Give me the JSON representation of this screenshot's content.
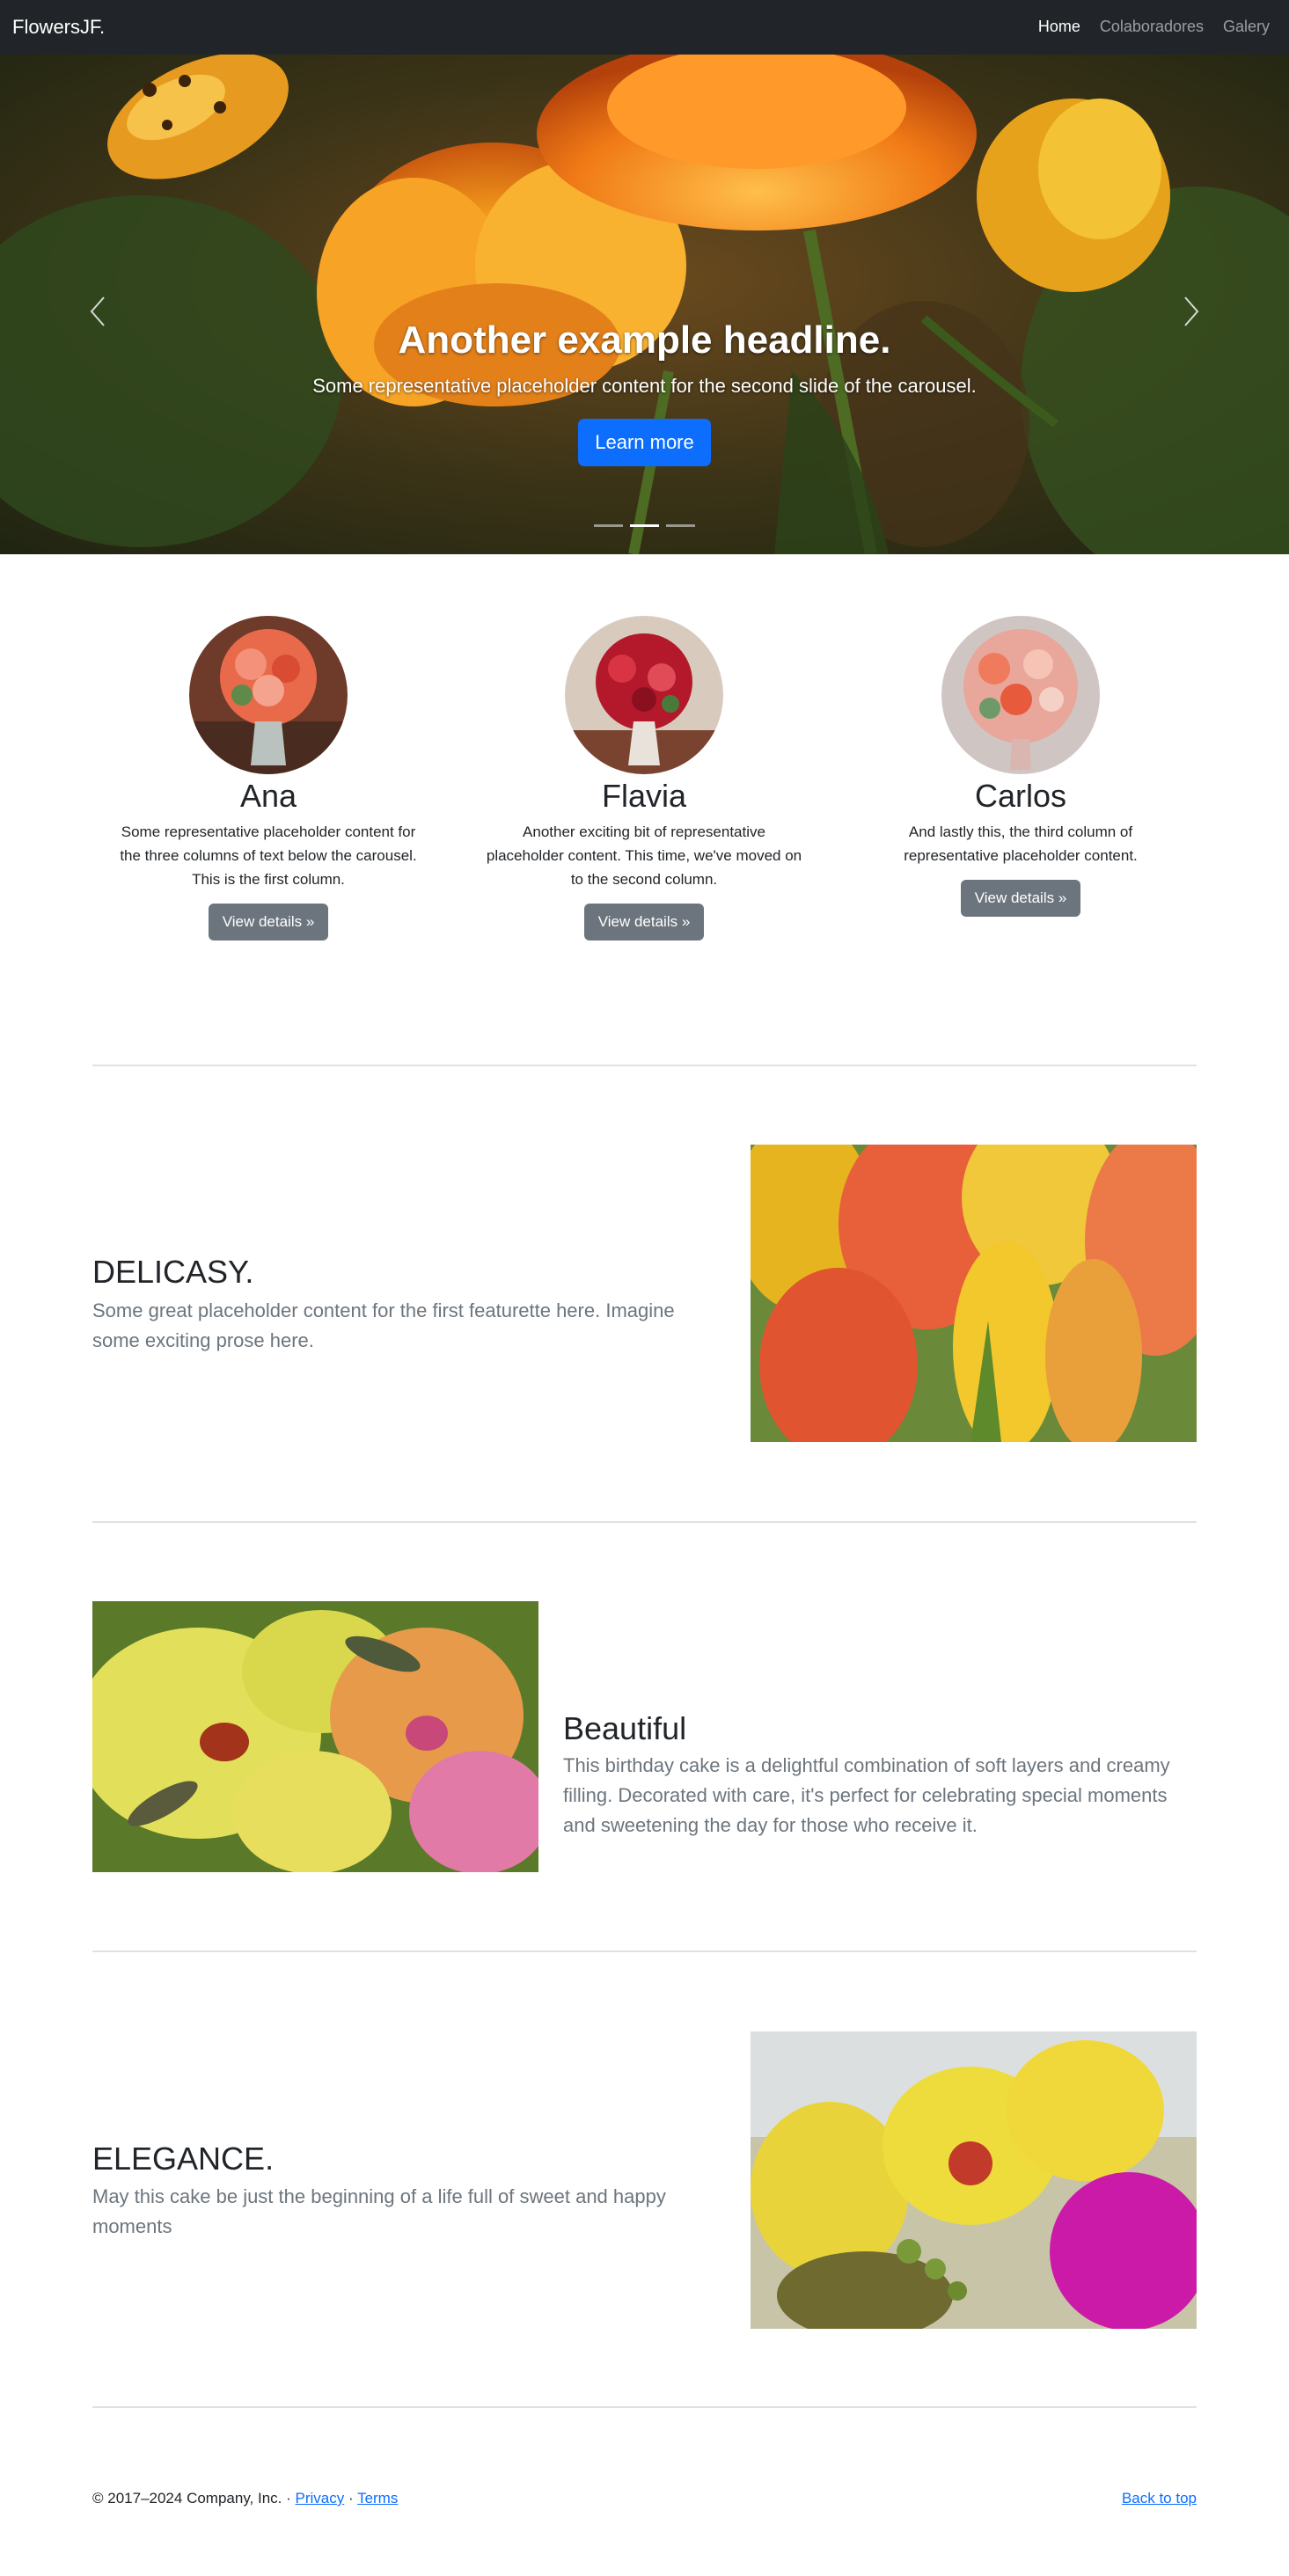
{
  "navbar": {
    "brand": "FlowersJF.",
    "links": [
      {
        "label": "Home",
        "active": true
      },
      {
        "label": "Colaboradores",
        "active": false
      },
      {
        "label": "Galery",
        "active": false
      }
    ]
  },
  "carousel": {
    "headline": "Another example headline.",
    "text": "Some representative placeholder content for the second slide of the carousel.",
    "button_label": "Learn more",
    "slide_count": 3,
    "active_slide": 2
  },
  "columns": [
    {
      "name": "Ana",
      "text": "Some representative placeholder content for the three columns of text below the carousel. This is the first column.",
      "button": "View details »"
    },
    {
      "name": "Flavia",
      "text": "Another exciting bit of representative placeholder content. This time, we've moved on to the second column.",
      "button": "View details »"
    },
    {
      "name": "Carlos",
      "text": "And lastly this, the third column of representative placeholder content.",
      "button": "View details »"
    }
  ],
  "featurettes": [
    {
      "heading": "DELICASY.",
      "text": "Some great placeholder content for the first featurette here. Imagine some exciting prose here."
    },
    {
      "heading": "Beautiful",
      "text": "This birthday cake is a delightful combination of soft layers and creamy filling. Decorated with care, it's perfect for celebrating special moments and sweetening the day for those who receive it."
    },
    {
      "heading": "ELEGANCE.",
      "text": "May this cake be just the beginning of a life full of sweet and happy moments"
    }
  ],
  "footer": {
    "copyright": "© 2017–2024 Company, Inc. · ",
    "privacy": "Privacy",
    "separator": " · ",
    "terms": "Terms",
    "back_to_top": "Back to top"
  },
  "colors": {
    "navbar_bg": "#212529",
    "primary": "#0d6efd",
    "secondary": "#6c757d"
  }
}
